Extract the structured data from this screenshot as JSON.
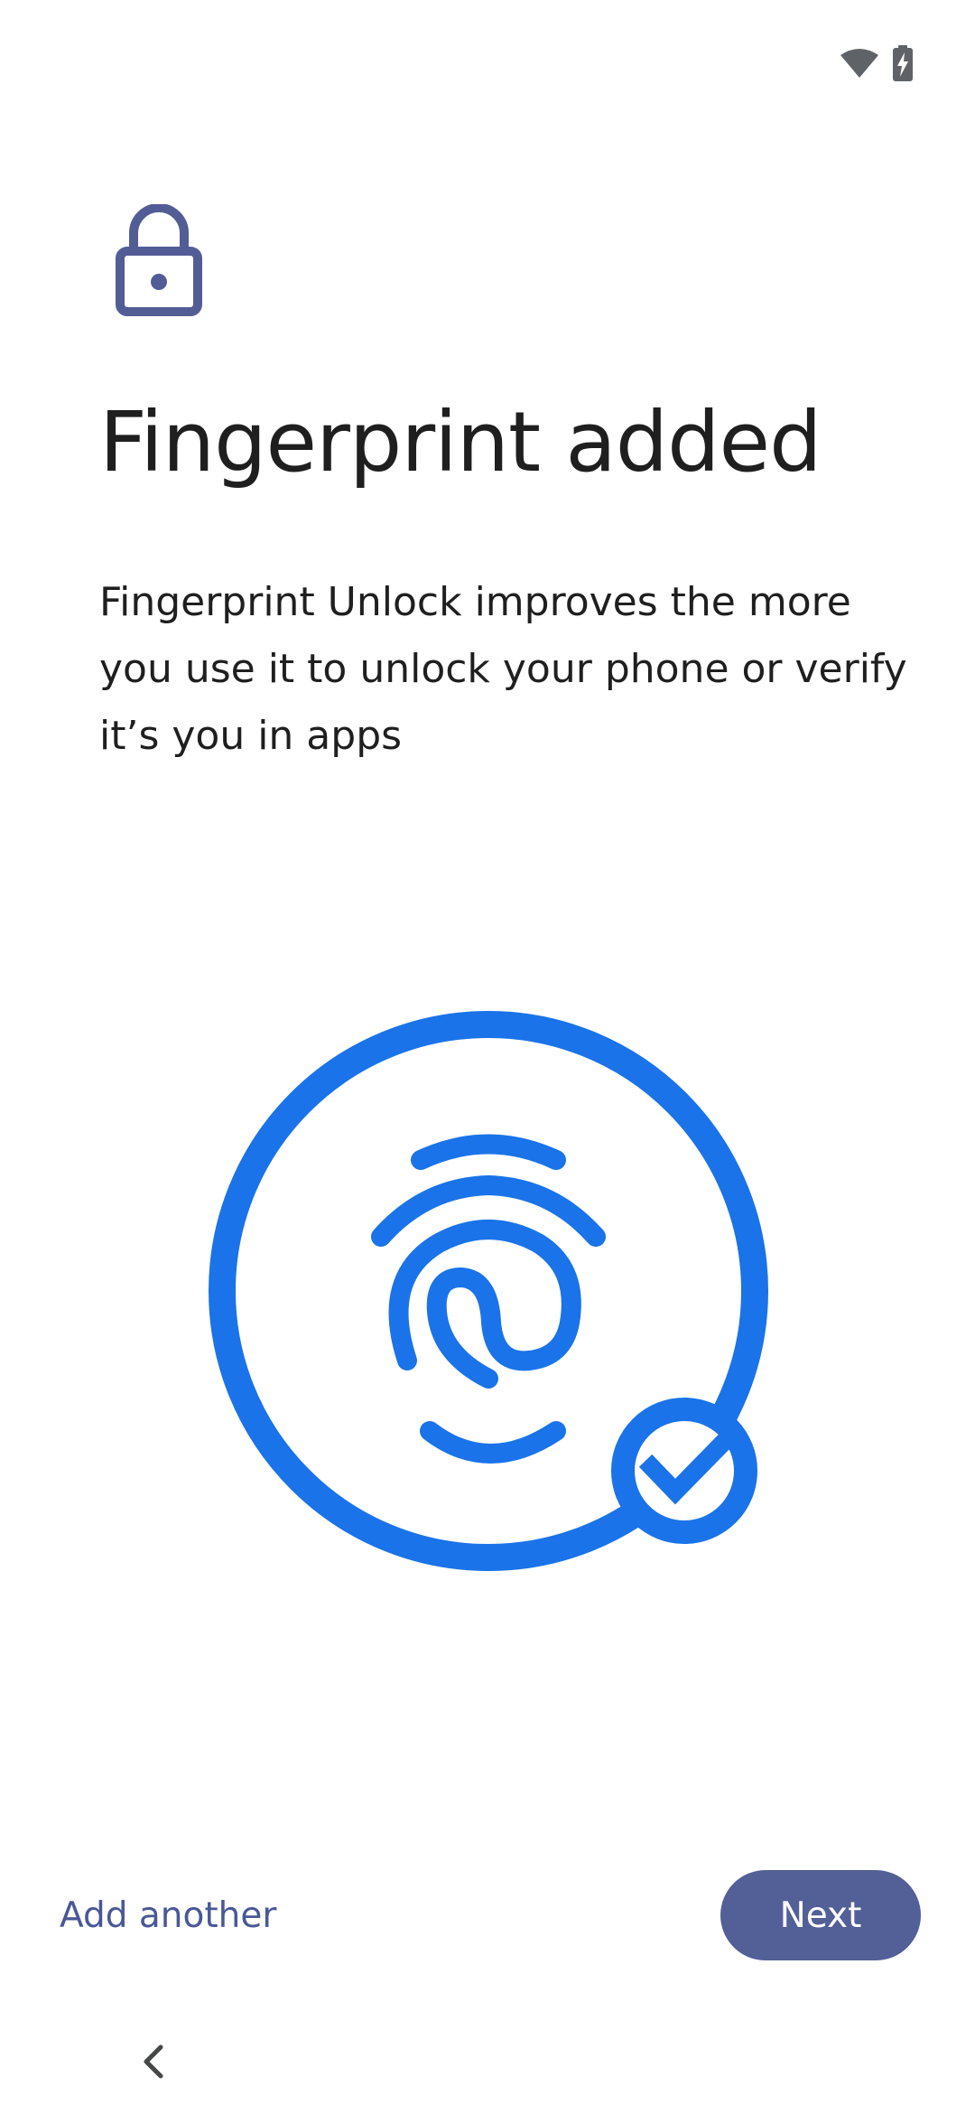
{
  "status_bar": {
    "icons": [
      "wifi-icon",
      "battery-charging-icon"
    ]
  },
  "header": {
    "icon": "lock-icon",
    "title": "Fingerprint added"
  },
  "main": {
    "description": "Fingerprint Unlock improves the more you use it to unlock your phone or verify it’s you in apps",
    "illustration": {
      "icon": "fingerprint-success-icon",
      "badge_icon": "checkmark-icon"
    }
  },
  "footer": {
    "secondary_action": "Add another",
    "primary_action": "Next"
  },
  "nav": {
    "back_icon": "back-chevron-icon"
  },
  "colors": {
    "accent_blue": "#1a73e8",
    "primary_button": "#535f97",
    "link_text": "#4a5797",
    "lock_icon": "#525d96"
  }
}
